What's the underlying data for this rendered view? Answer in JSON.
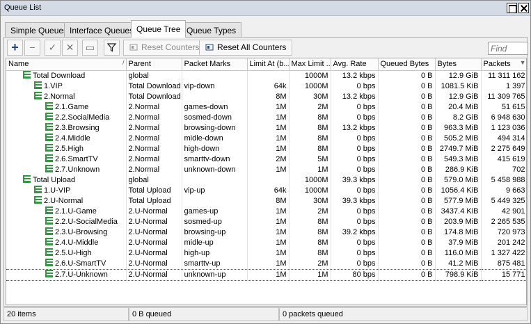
{
  "window": {
    "title": "Queue List"
  },
  "tabs": [
    {
      "label": "Simple Queues",
      "active": false
    },
    {
      "label": "Interface Queues",
      "active": false
    },
    {
      "label": "Queue Tree",
      "active": true
    },
    {
      "label": "Queue Types",
      "active": false
    }
  ],
  "toolbar": {
    "add_icon": "plus-icon",
    "remove_icon": "minus-icon",
    "enable_icon": "check-icon",
    "disable_icon": "cross-icon",
    "comment_icon": "comment-icon",
    "filter_icon": "filter-icon",
    "reset_counters": "Reset Counters",
    "reset_all_counters": "Reset All Counters",
    "find_placeholder": "Find"
  },
  "table": {
    "columns": [
      "Name",
      "Parent",
      "Packet Marks",
      "Limit At (b...",
      "Max Limit ...",
      "Avg. Rate",
      "Queued Bytes",
      "Bytes",
      "Packets"
    ],
    "rows": [
      {
        "level": 0,
        "name": "Total Download",
        "parent": "global",
        "marks": "",
        "limit_at": "",
        "max_limit": "1000M",
        "avg_rate": "13.2 kbps",
        "queued": "0 B",
        "bytes": "12.9 GiB",
        "packets": "11 311 162"
      },
      {
        "level": 1,
        "name": "1.VIP",
        "parent": "Total Download",
        "marks": "vip-down",
        "limit_at": "64k",
        "max_limit": "1000M",
        "avg_rate": "0 bps",
        "queued": "0 B",
        "bytes": "1081.5 KiB",
        "packets": "1 397"
      },
      {
        "level": 1,
        "name": "2.Normal",
        "parent": "Total Download",
        "marks": "",
        "limit_at": "8M",
        "max_limit": "30M",
        "avg_rate": "13.2 kbps",
        "queued": "0 B",
        "bytes": "12.9 GiB",
        "packets": "11 309 765"
      },
      {
        "level": 2,
        "name": "2.1.Game",
        "parent": "2.Normal",
        "marks": "games-down",
        "limit_at": "1M",
        "max_limit": "2M",
        "avg_rate": "0 bps",
        "queued": "0 B",
        "bytes": "20.4 MiB",
        "packets": "51 615"
      },
      {
        "level": 2,
        "name": "2.2.SocialMedia",
        "parent": "2.Normal",
        "marks": "sosmed-down",
        "limit_at": "1M",
        "max_limit": "8M",
        "avg_rate": "0 bps",
        "queued": "0 B",
        "bytes": "8.2 GiB",
        "packets": "6 948 630"
      },
      {
        "level": 2,
        "name": "2.3.Browsing",
        "parent": "2.Normal",
        "marks": "browsing-down",
        "limit_at": "1M",
        "max_limit": "8M",
        "avg_rate": "13.2 kbps",
        "queued": "0 B",
        "bytes": "963.3 MiB",
        "packets": "1 123 036"
      },
      {
        "level": 2,
        "name": "2.4.Middle",
        "parent": "2.Normal",
        "marks": "midle-down",
        "limit_at": "1M",
        "max_limit": "8M",
        "avg_rate": "0 bps",
        "queued": "0 B",
        "bytes": "505.2 MiB",
        "packets": "494 314"
      },
      {
        "level": 2,
        "name": "2.5.High",
        "parent": "2.Normal",
        "marks": "high-down",
        "limit_at": "1M",
        "max_limit": "8M",
        "avg_rate": "0 bps",
        "queued": "0 B",
        "bytes": "2749.7 MiB",
        "packets": "2 275 649"
      },
      {
        "level": 2,
        "name": "2.6.SmartTV",
        "parent": "2.Normal",
        "marks": "smarttv-down",
        "limit_at": "2M",
        "max_limit": "5M",
        "avg_rate": "0 bps",
        "queued": "0 B",
        "bytes": "549.3 MiB",
        "packets": "415 619"
      },
      {
        "level": 2,
        "name": "2.7.Unknown",
        "parent": "2.Normal",
        "marks": "unknown-down",
        "limit_at": "1M",
        "max_limit": "1M",
        "avg_rate": "0 bps",
        "queued": "0 B",
        "bytes": "286.9 KiB",
        "packets": "702"
      },
      {
        "level": 0,
        "name": "Total Upload",
        "parent": "global",
        "marks": "",
        "limit_at": "",
        "max_limit": "1000M",
        "avg_rate": "39.3 kbps",
        "queued": "0 B",
        "bytes": "579.0 MiB",
        "packets": "5 458 988"
      },
      {
        "level": 1,
        "name": "1.U-VIP",
        "parent": "Total Upload",
        "marks": "vip-up",
        "limit_at": "64k",
        "max_limit": "1000M",
        "avg_rate": "0 bps",
        "queued": "0 B",
        "bytes": "1056.4 KiB",
        "packets": "9 663"
      },
      {
        "level": 1,
        "name": "2.U-Normal",
        "parent": "Total Upload",
        "marks": "",
        "limit_at": "8M",
        "max_limit": "30M",
        "avg_rate": "39.3 kbps",
        "queued": "0 B",
        "bytes": "577.9 MiB",
        "packets": "5 449 325"
      },
      {
        "level": 2,
        "name": "2.1.U-Game",
        "parent": "2.U-Normal",
        "marks": "games-up",
        "limit_at": "1M",
        "max_limit": "2M",
        "avg_rate": "0 bps",
        "queued": "0 B",
        "bytes": "3437.4 KiB",
        "packets": "42 901"
      },
      {
        "level": 2,
        "name": "2.2.U-SocialMedia",
        "parent": "2.U-Normal",
        "marks": "sosmed-up",
        "limit_at": "1M",
        "max_limit": "8M",
        "avg_rate": "0 bps",
        "queued": "0 B",
        "bytes": "203.9 MiB",
        "packets": "2 265 535"
      },
      {
        "level": 2,
        "name": "2.3.U-Browsing",
        "parent": "2.U-Normal",
        "marks": "browsing-up",
        "limit_at": "1M",
        "max_limit": "8M",
        "avg_rate": "39.2 kbps",
        "queued": "0 B",
        "bytes": "174.8 MiB",
        "packets": "720 973"
      },
      {
        "level": 2,
        "name": "2.4.U-Middle",
        "parent": "2.U-Normal",
        "marks": "midle-up",
        "limit_at": "1M",
        "max_limit": "8M",
        "avg_rate": "0 bps",
        "queued": "0 B",
        "bytes": "37.9 MiB",
        "packets": "201 242"
      },
      {
        "level": 2,
        "name": "2.5.U-High",
        "parent": "2.U-Normal",
        "marks": "high-up",
        "limit_at": "1M",
        "max_limit": "8M",
        "avg_rate": "0 bps",
        "queued": "0 B",
        "bytes": "116.0 MiB",
        "packets": "1 327 422"
      },
      {
        "level": 2,
        "name": "2.6.U-SmartTV",
        "parent": "2.U-Normal",
        "marks": "smarttv-up",
        "limit_at": "1M",
        "max_limit": "2M",
        "avg_rate": "0 bps",
        "queued": "0 B",
        "bytes": "41.2 MiB",
        "packets": "875 481"
      },
      {
        "level": 2,
        "name": "2.7.U-Unknown",
        "parent": "2.U-Normal",
        "marks": "unknown-up",
        "limit_at": "1M",
        "max_limit": "1M",
        "avg_rate": "80 bps",
        "queued": "0 B",
        "bytes": "798.9 KiB",
        "packets": "15 771",
        "selected": true
      }
    ]
  },
  "status": {
    "items": "20 items",
    "queued_bytes": "0 B queued",
    "queued_packets": "0 packets queued"
  },
  "colors": {
    "queue_icon": "#2a9a3a",
    "add_icon": "#1f3f9a"
  }
}
